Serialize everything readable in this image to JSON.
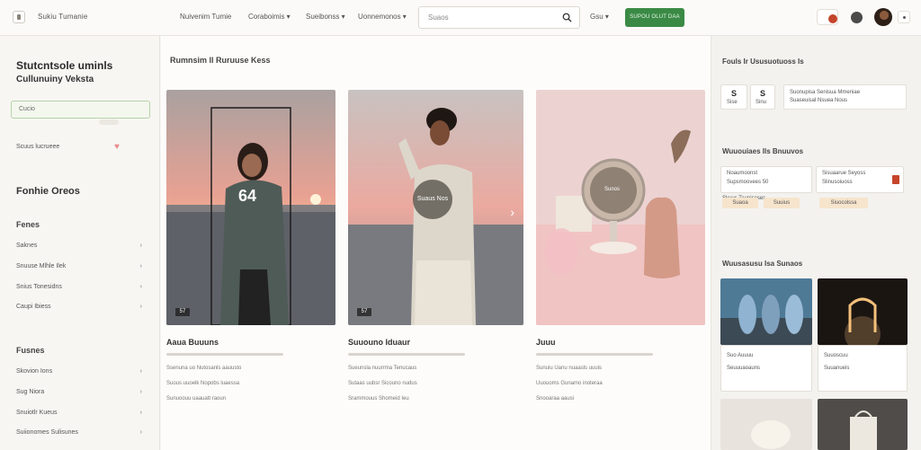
{
  "header": {
    "brand": "Sukiu Tumanie",
    "nav": [
      "Nuivenim Tumie",
      "Coraboimis ▾",
      "Sueibonss ▾",
      "Uonnemonos ▾"
    ],
    "search_placeholder": "Suaos",
    "help": "Gsu ▾",
    "cta": "SUPOU OLUT DAA"
  },
  "sidebar": {
    "title_line1": "Stutcntsole uminls",
    "title_line2": "Cullunuiny Veksta",
    "search_placeholder": "Cucio",
    "favorites": "Scuus lucrueee",
    "section_heading": "Fonhie Oreos",
    "group1_title": "Fenes",
    "group1_items": [
      "Saknes",
      "Snuuse Mlhle Ilek",
      "Snius Tonesidns",
      "Caupi Ibiess"
    ],
    "group2_title": "Fusnes",
    "group2_items": [
      "Skovion Ions",
      "Sug Niora",
      "Snuiotlr Kueus",
      "Suiionomes Sulisunes"
    ]
  },
  "main": {
    "heading": "Rumnsim ll Ruruuse Kess",
    "cards": [
      {
        "title": "Aaua Buuuns",
        "badge": "57",
        "overlay": "64",
        "lines": [
          "Ssenuna uo Nutosanls aauusto",
          "Suous uuoelk Nopobs luaessa",
          "Sunuoouu uaauatt raoun"
        ]
      },
      {
        "title": "Suuouno Iduaur",
        "badge": "57",
        "overlay": "Suaus Nos",
        "lines": [
          "Sueunsla nuurrma Tenucaus",
          "Sutaas uubsr Sicouno nudus",
          "Srammouus Shomeid Ieu"
        ]
      },
      {
        "title": "Juuu",
        "badge": "",
        "overlay": "Sunos",
        "lines": [
          "Sunuiu Uanu nuaasls uuuis",
          "Uuouoms Gunamo inoteraa",
          "Snooaraa aausi"
        ]
      }
    ]
  },
  "rightpanel": {
    "heading1": "Fouls Ir Ususuotuoss Is",
    "stat1": "S",
    "stat1_sub": "Sise",
    "stat2": "S",
    "stat2_sub": "Sinu",
    "stat_note": "Suonupisa Senisua Mmeniae\nSuaseuisal Nsuea Nous",
    "heading2": "Wuuouiaes Ils Bnuuvos",
    "box1_lines": [
      "Noaumoonst",
      "Supsmoovees 50",
      "Skuus Tauniseses"
    ],
    "box1_chips": [
      "Suaoa",
      "Suuius"
    ],
    "box2_lines": [
      "Sisuaarue Seyoss",
      "Slinusoiuoss"
    ],
    "box2_chip": "Siuocolssa",
    "heading3": "Wuusasusu Isa Sunaos",
    "tile1_lines": [
      "Suo Auuuu",
      "Seuuuaoauns"
    ],
    "tile2_lines": [
      "Suuoscuu",
      "Suuanueis"
    ]
  }
}
